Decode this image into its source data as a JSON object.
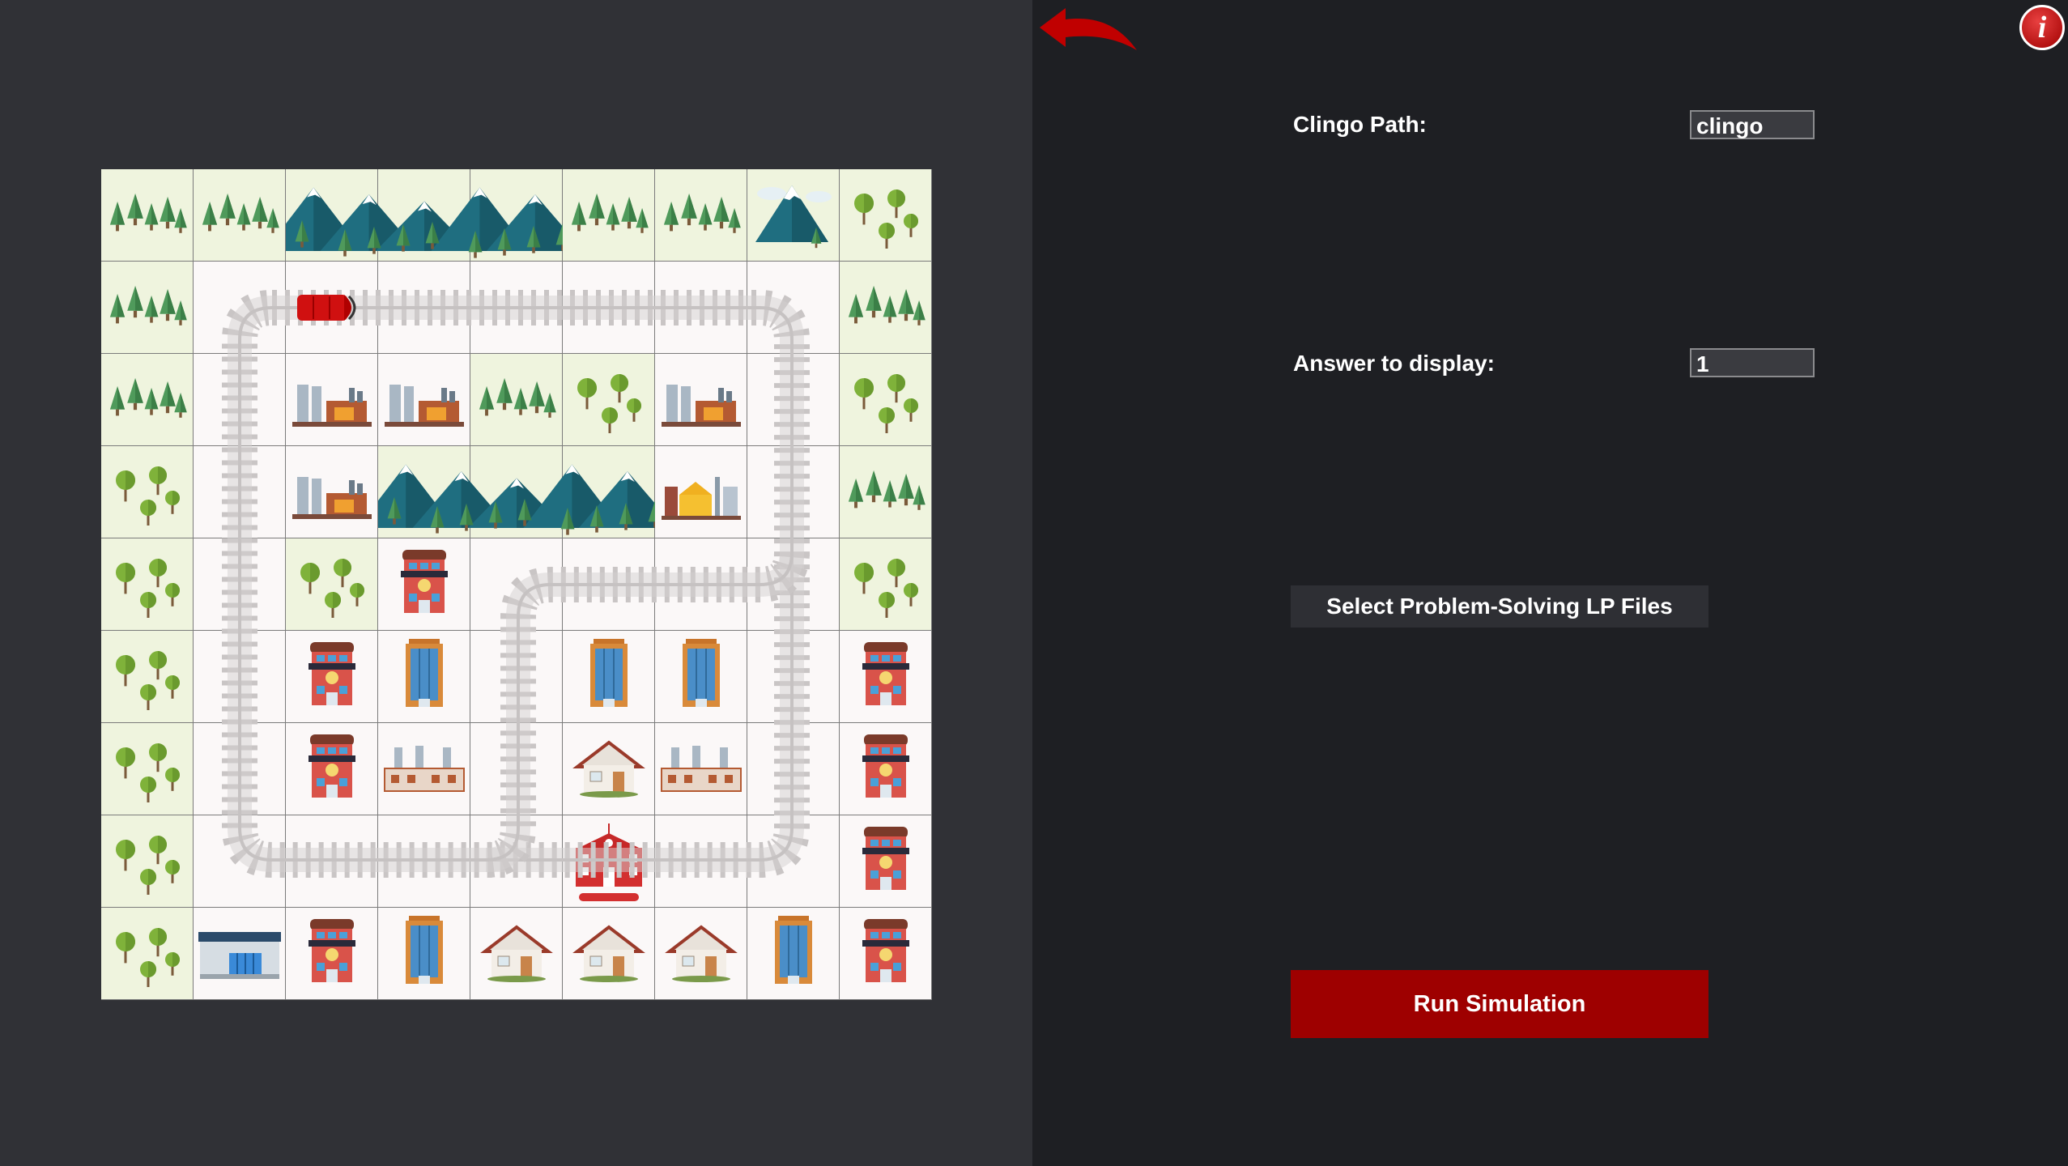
{
  "controls": {
    "clingo_path_label": "Clingo Path:",
    "clingo_path_value": "clingo",
    "answer_label": "Answer to display:",
    "answer_value": "1",
    "select_files_label": "Select Problem-Solving LP Files",
    "run_label": "Run Simulation",
    "info_glyph": "i",
    "back_icon": "back-arrow-icon"
  },
  "colors": {
    "left_panel": "#303136",
    "right_panel": "#1e1f23",
    "run_button": "#9e0000",
    "accent_red": "#cc0000",
    "grass": "#eff4de",
    "ground": "#fbf8f8"
  },
  "map": {
    "rows": 9,
    "cols": 9,
    "cells": [
      [
        "pine-trees",
        "pine-trees",
        "mountains",
        "mountains",
        "mountains",
        "pine-trees",
        "pine-trees",
        "snowy-mountain",
        "round-trees"
      ],
      [
        "pine-trees",
        "track",
        "track-train",
        "track",
        "track",
        "track",
        "track",
        "track",
        "pine-trees"
      ],
      [
        "pine-trees",
        "track",
        "power-plant",
        "power-plant",
        "pine-trees",
        "round-trees",
        "power-plant",
        "track",
        "round-trees"
      ],
      [
        "round-trees",
        "track",
        "power-plant",
        "mountains",
        "mountains",
        "mountains",
        "factory",
        "track",
        "pine-trees"
      ],
      [
        "round-trees",
        "track",
        "round-trees",
        "apartment",
        "track",
        "track",
        "track",
        "track",
        "round-trees"
      ],
      [
        "round-trees",
        "track",
        "apartment",
        "office-tower",
        "track",
        "office-tower",
        "office-tower",
        "track",
        "apartment"
      ],
      [
        "round-trees",
        "track",
        "apartment",
        "industrial-plant",
        "track",
        "house",
        "industrial-plant",
        "track",
        "apartment"
      ],
      [
        "round-trees",
        "track",
        "track",
        "track",
        "track",
        "school",
        "track",
        "track",
        "apartment"
      ],
      [
        "round-trees",
        "warehouse",
        "apartment",
        "office-tower",
        "house",
        "house",
        "house",
        "office-tower",
        "apartment"
      ]
    ]
  }
}
